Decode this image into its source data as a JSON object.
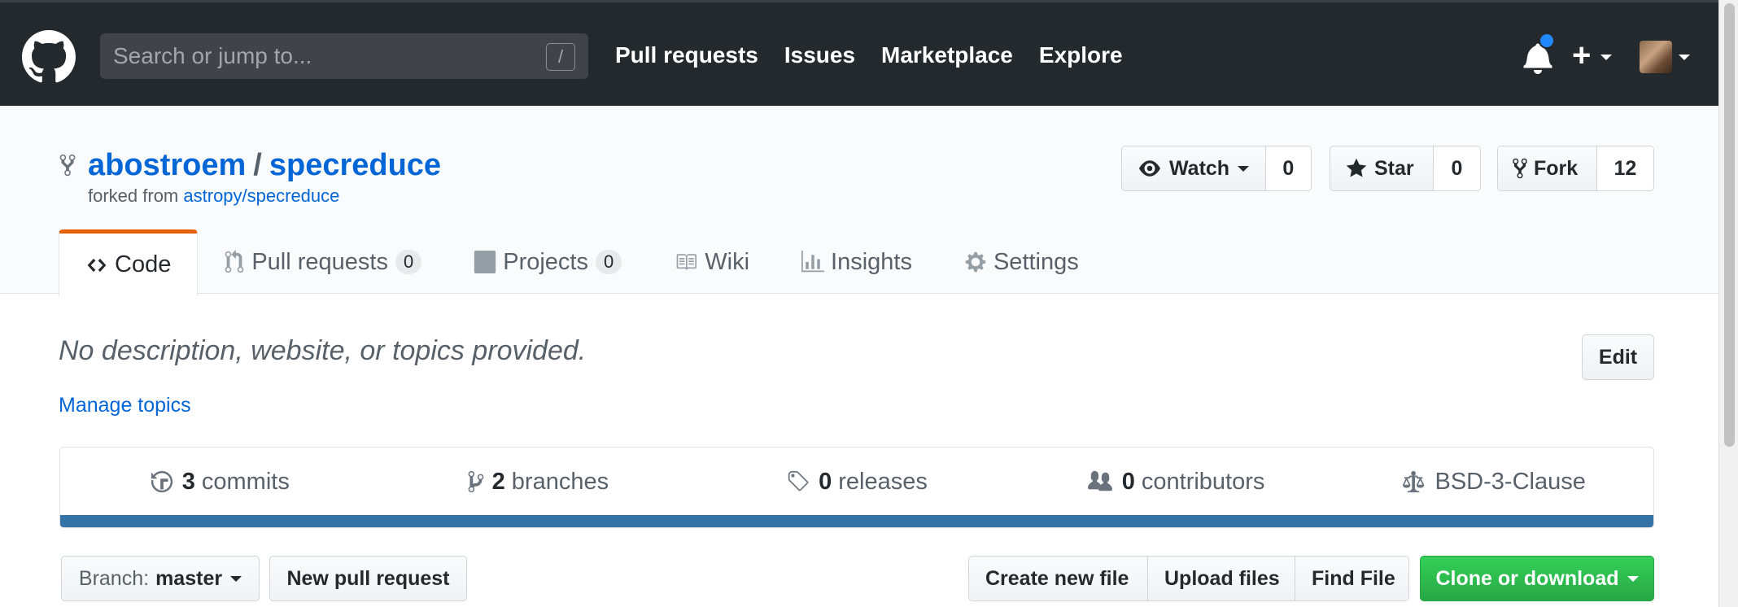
{
  "header": {
    "search_placeholder": "Search or jump to...",
    "search_shortcut": "/",
    "nav": [
      "Pull requests",
      "Issues",
      "Marketplace",
      "Explore"
    ]
  },
  "repo": {
    "owner": "abostroem",
    "separator": "/",
    "name": "specreduce",
    "forked_prefix": "forked from",
    "forked_from": "astropy/specreduce"
  },
  "actions": {
    "watch_label": "Watch",
    "watch_count": "0",
    "star_label": "Star",
    "star_count": "0",
    "fork_label": "Fork",
    "fork_count": "12"
  },
  "tabs": {
    "code": "Code",
    "pulls": "Pull requests",
    "pulls_count": "0",
    "projects": "Projects",
    "projects_count": "0",
    "wiki": "Wiki",
    "insights": "Insights",
    "settings": "Settings"
  },
  "description": {
    "text": "No description, website, or topics provided.",
    "manage_topics": "Manage topics",
    "edit_label": "Edit"
  },
  "summary": {
    "commits_count": "3",
    "commits_label": "commits",
    "branches_count": "2",
    "branches_label": "branches",
    "releases_count": "0",
    "releases_label": "releases",
    "contributors_count": "0",
    "contributors_label": "contributors",
    "license": "BSD-3-Clause",
    "language_color": "#3572a5"
  },
  "file_nav": {
    "branch_label": "Branch:",
    "branch_value": "master",
    "new_pr": "New pull request",
    "create_file": "Create new file",
    "upload_files": "Upload files",
    "find_file": "Find File",
    "clone": "Clone or download"
  },
  "colors": {
    "header_bg": "#24292e",
    "link": "#0366d6",
    "selected_tab_accent": "#e36209",
    "primary_button": "#28a745",
    "notification_dot": "#2188ff"
  }
}
